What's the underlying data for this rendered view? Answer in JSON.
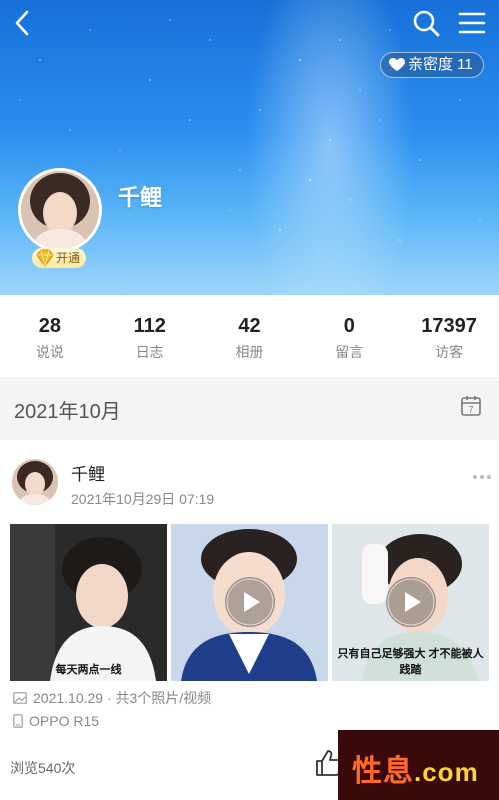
{
  "header": {
    "intimacy_label": "亲密度 11",
    "username": "千鲤",
    "vip_label": "开通"
  },
  "stats": [
    {
      "value": "28",
      "label": "说说"
    },
    {
      "value": "112",
      "label": "日志"
    },
    {
      "value": "42",
      "label": "相册"
    },
    {
      "value": "0",
      "label": "留言"
    },
    {
      "value": "17397",
      "label": "访客"
    }
  ],
  "month": {
    "label": "2021年10月",
    "calendar_day": "7"
  },
  "post": {
    "author": "千鲤",
    "time": "2021年10月29日 07:19",
    "thumbs": [
      {
        "caption": "每天两点一线",
        "is_video": false
      },
      {
        "caption": "",
        "is_video": true
      },
      {
        "caption": "只有自己足够强大 才不能被人践踏",
        "is_video": true
      }
    ],
    "album_info": "2021.10.29 · 共3个照片/视频",
    "device": "OPPO R15",
    "views": "浏览540次"
  },
  "watermark": {
    "text": "性息",
    "suffix": ".com"
  },
  "colors": {
    "sky_top": "#1670d8",
    "sky_bottom": "#9ed6f9",
    "watermark_orange": "#ff6a2a"
  }
}
